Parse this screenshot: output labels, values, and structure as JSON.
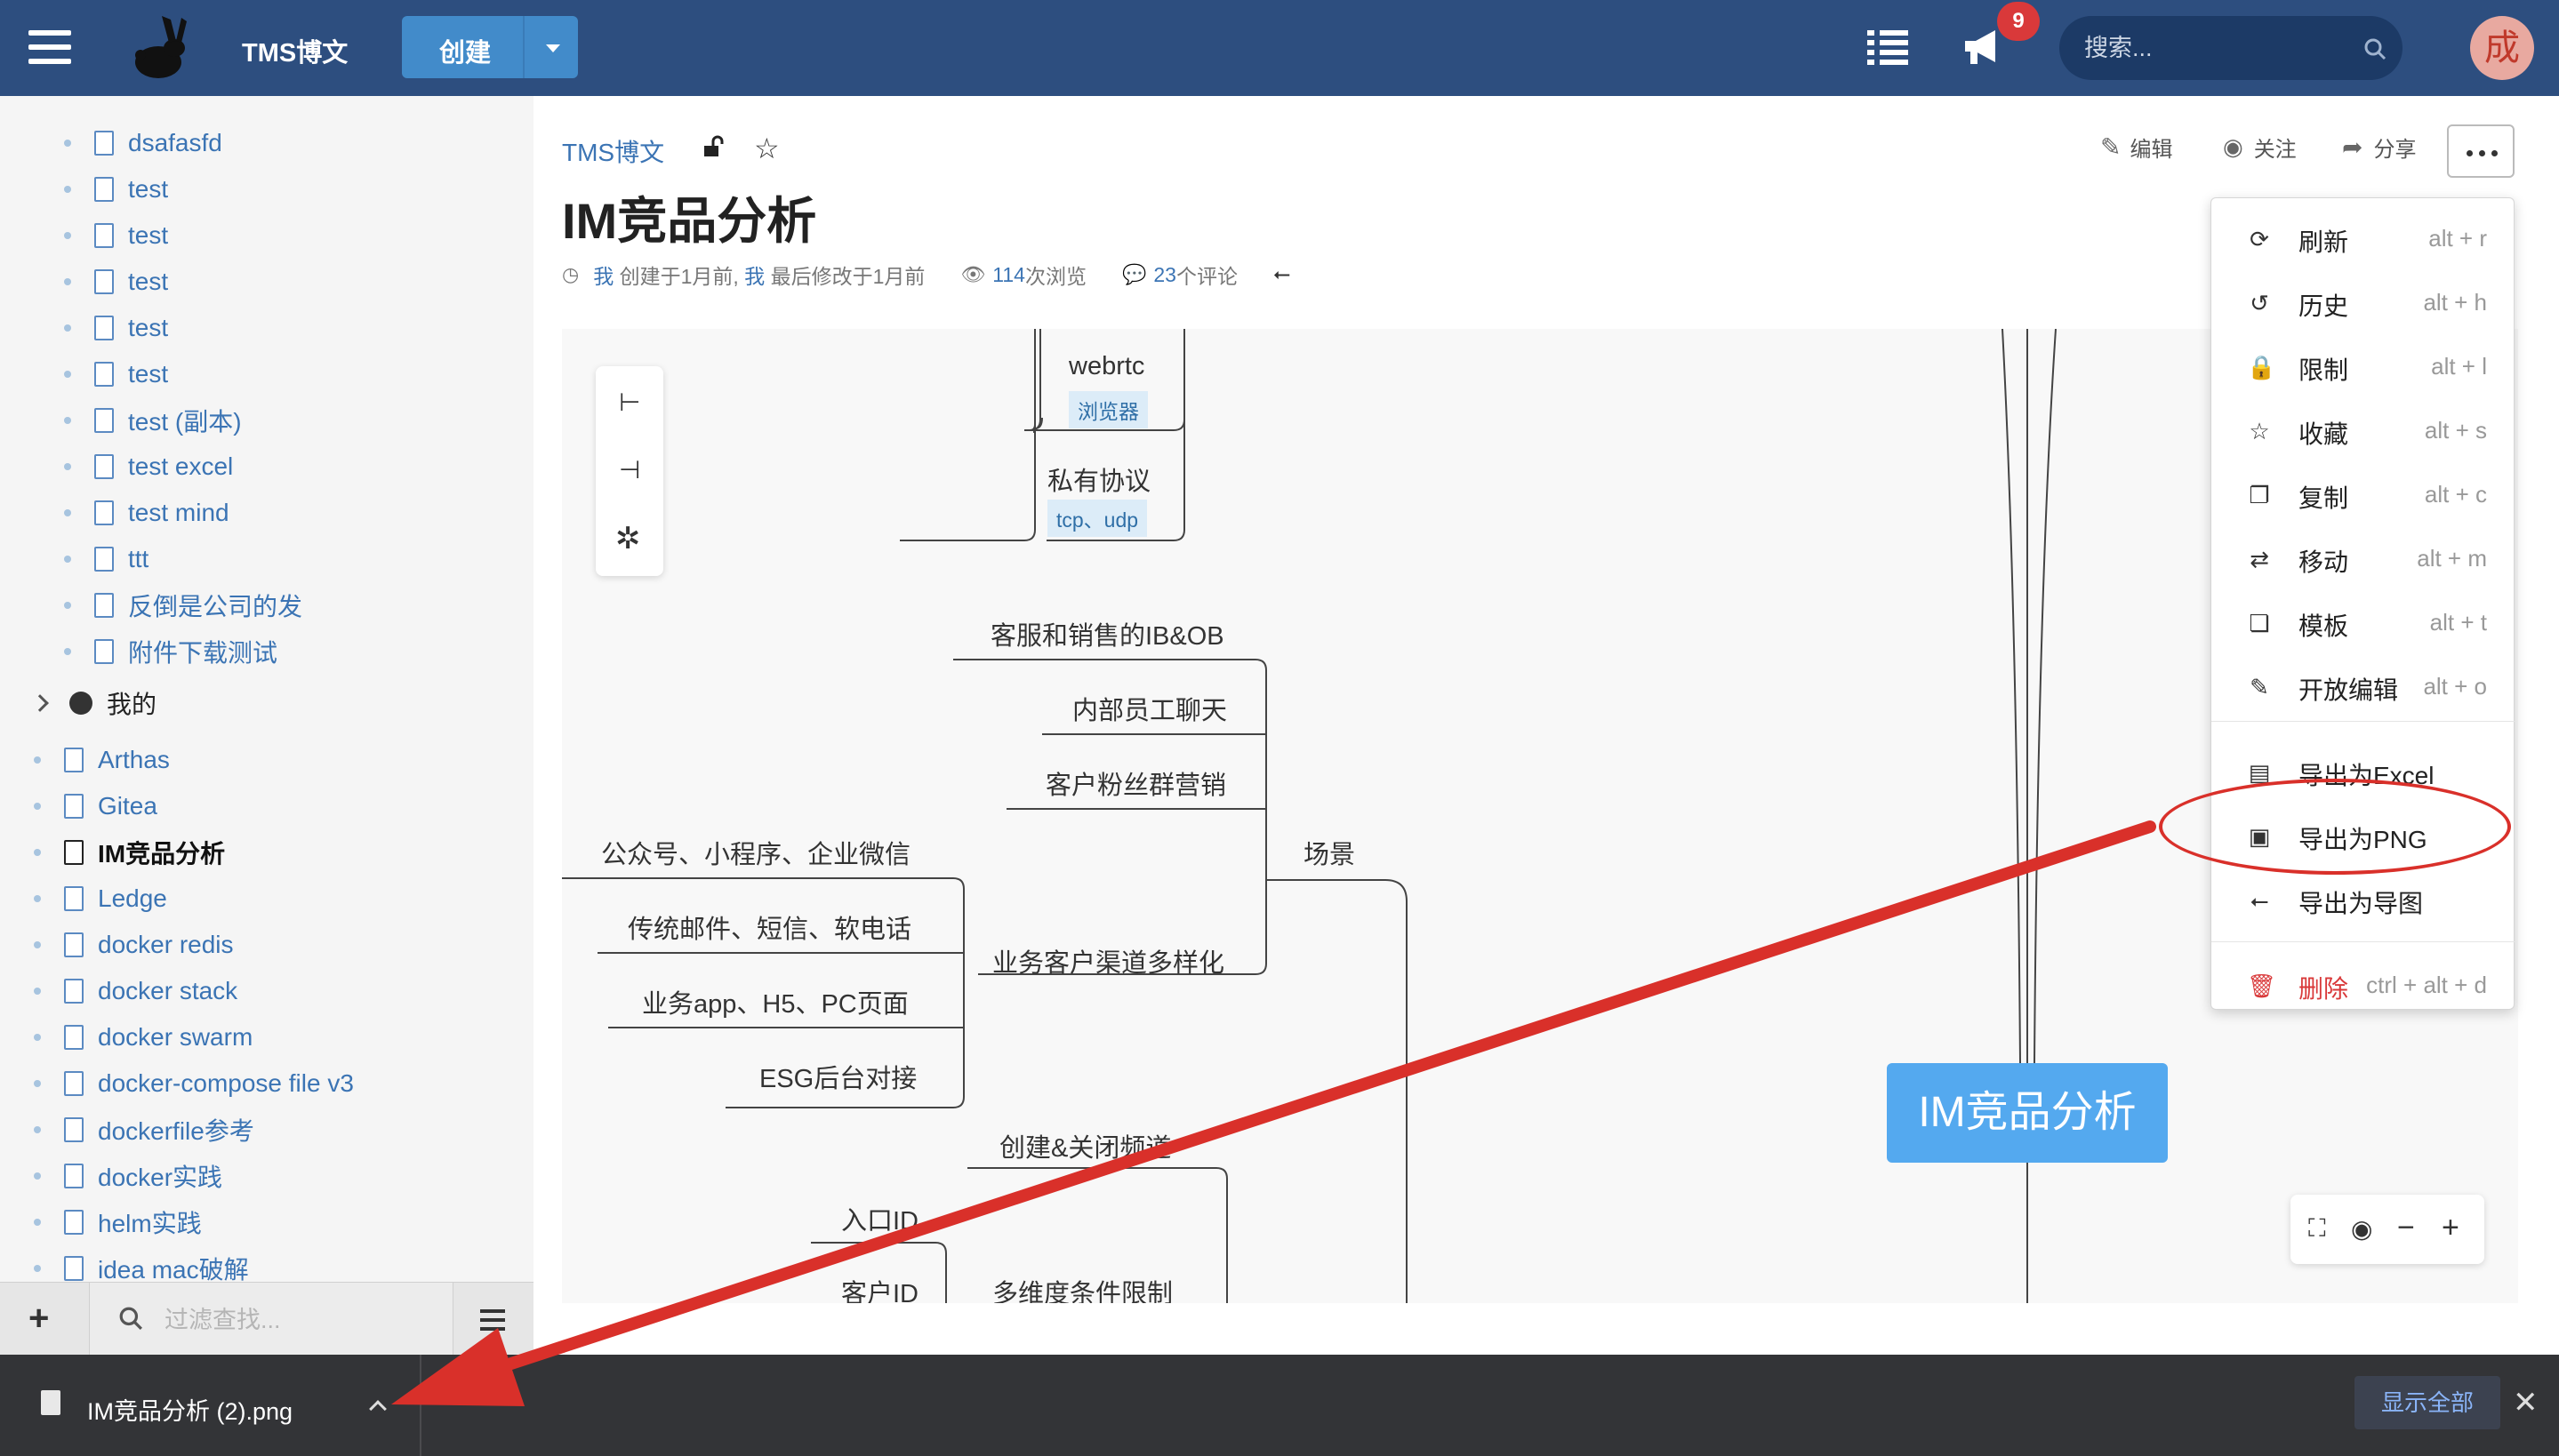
{
  "topbar": {
    "brand": "TMS博文",
    "create_label": "创建",
    "notification_count": "9",
    "search_placeholder": "搜索...",
    "avatar_text": "成"
  },
  "sidebar": {
    "items_top": [
      {
        "label": "dsafasfd"
      },
      {
        "label": "test"
      },
      {
        "label": "test"
      },
      {
        "label": "test"
      },
      {
        "label": "test"
      },
      {
        "label": "test"
      },
      {
        "label": "test (副本)"
      },
      {
        "label": "test excel"
      },
      {
        "label": "test mind"
      },
      {
        "label": "ttt"
      },
      {
        "label": "反倒是公司的发"
      },
      {
        "label": "附件下载测试"
      }
    ],
    "group_label": "我的",
    "items_mine": [
      {
        "label": "Arthas"
      },
      {
        "label": "Gitea"
      },
      {
        "label": "IM竞品分析",
        "active": true
      },
      {
        "label": "Ledge"
      },
      {
        "label": "docker redis"
      },
      {
        "label": "docker stack"
      },
      {
        "label": "docker swarm"
      },
      {
        "label": "docker-compose file v3"
      },
      {
        "label": "dockerfile参考"
      },
      {
        "label": "docker实践"
      },
      {
        "label": "helm实践"
      },
      {
        "label": "idea mac破解"
      }
    ],
    "filter_placeholder": "过滤查找..."
  },
  "main": {
    "breadcrumb": "TMS博文",
    "title": "IM竞品分析",
    "meta": {
      "author1": "我",
      "created": "创建于1月前,",
      "author2": "我",
      "modified": "最后修改于1月前",
      "views_num": "114",
      "views_text": "次浏览",
      "comments_num": "23",
      "comments_text": "个评论"
    },
    "actions": {
      "edit": "编辑",
      "watch": "关注",
      "share": "分享"
    }
  },
  "mindmap": {
    "root": "IM竞品分析",
    "nodes": {
      "webrtc": "webrtc",
      "webrtc_tag": "浏览器",
      "private_proto": "私有协议",
      "private_tag": "tcp、udp",
      "ib_ob": "客服和销售的IB&OB",
      "internal_chat": "内部员工聊天",
      "fan_marketing": "客户粉丝群营销",
      "scene": "场景",
      "channels": "业务客户渠道多样化",
      "wechat": "公众号、小程序、企业微信",
      "traditional": "传统邮件、短信、软电话",
      "app": "业务app、H5、PC页面",
      "esg": "ESG后台对接",
      "create_close": "创建&关闭频道",
      "entry_id": "入口ID",
      "customer_id": "客户ID",
      "multi_dim": "多维度条件限制"
    }
  },
  "dropdown": {
    "items": [
      {
        "icon": "refresh-icon",
        "label": "刷新",
        "key": "alt + r"
      },
      {
        "icon": "history-icon",
        "label": "历史",
        "key": "alt + h"
      },
      {
        "icon": "lock-icon",
        "label": "限制",
        "key": "alt + l"
      },
      {
        "icon": "star-icon",
        "label": "收藏",
        "key": "alt + s"
      },
      {
        "icon": "copy-icon",
        "label": "复制",
        "key": "alt + c"
      },
      {
        "icon": "move-icon",
        "label": "移动",
        "key": "alt + m"
      },
      {
        "icon": "template-icon",
        "label": "模板",
        "key": "alt + t"
      },
      {
        "icon": "pencil-icon",
        "label": "开放编辑",
        "key": "alt + o"
      },
      {
        "icon": "excel-icon",
        "label": "导出为Excel",
        "key": ""
      },
      {
        "icon": "image-icon",
        "label": "导出为PNG",
        "key": ""
      },
      {
        "icon": "usb-icon",
        "label": "导出为导图",
        "key": ""
      },
      {
        "icon": "trash-icon",
        "label": "删除",
        "key": "ctrl + alt + d"
      }
    ]
  },
  "downloads": {
    "file_name": "IM竞品分析 (2).png",
    "show_all": "显示全部"
  },
  "colors": {
    "topbar": "#2d4e7f",
    "accent": "#428bca",
    "root_node": "#54a9ef",
    "annotation_red": "#d9302a",
    "download_bar": "#333437"
  }
}
